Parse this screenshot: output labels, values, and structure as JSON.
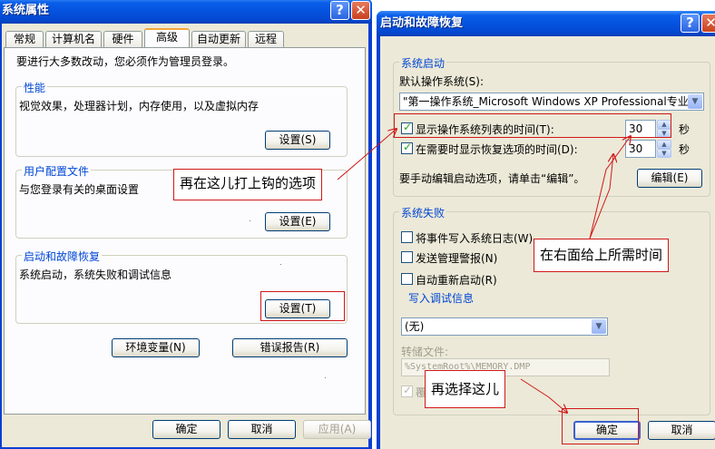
{
  "sys_props": {
    "title": "系统属性",
    "help": "?",
    "close": "✕",
    "tabs": [
      "常规",
      "计算机名",
      "硬件",
      "高级",
      "自动更新",
      "远程"
    ],
    "notice": "要进行大多数改动，您必须作为管理员登录。",
    "performance": {
      "title": "性能",
      "desc": "视觉效果，处理器计划，内存使用，以及虚拟内存",
      "button": "设置(S)"
    },
    "user_profiles": {
      "title": "用户配置文件",
      "desc": "与您登录有关的桌面设置",
      "button": "设置(E)"
    },
    "startup_recovery": {
      "title": "启动和故障恢复",
      "desc": "系统启动，系统失败和调试信息",
      "button": "设置(T)"
    },
    "env_vars": "环境变量(N)",
    "error_report": "错误报告(R)",
    "ok": "确定",
    "cancel": "取消",
    "apply": "应用(A)"
  },
  "startup_dialog": {
    "title": "启动和故障恢复",
    "help": "?",
    "close": "✕",
    "system_startup": {
      "title": "系统启动",
      "default_os_label": "默认操作系统(S):",
      "default_os_value": "\"第一操作系统_Microsoft Windows XP Professional专业",
      "show_list_label": "显示操作系统列表的时间(T):",
      "show_list_value": "30",
      "show_recovery_label": "在需要时显示恢复选项的时间(D):",
      "show_recovery_value": "30",
      "seconds": "秒",
      "edit_hint": "要手动编辑启动选项，请单击“编辑”。",
      "edit_button": "编辑(E)"
    },
    "system_failure": {
      "title": "系统失败",
      "write_event": "将事件写入系统日志(W)",
      "send_alert": "发送管理警报(N)",
      "auto_restart": "自动重新启动(R)",
      "debug_title": "写入调试信息",
      "debug_value": "(无)",
      "dump_file_label": "转储文件:",
      "dump_file_value": "%SystemRoot%\\MEMORY.DMP",
      "overwrite_partial": "覆"
    },
    "ok": "确定",
    "cancel": "取消"
  },
  "annotations": {
    "check_here": "再在这儿打上钩的选项",
    "set_time": "在右面给上所需时间",
    "select_here": "再选择这儿"
  },
  "colors": {
    "annotation": "#d01818",
    "group_title": "#0046d5",
    "title_bar": "#0553e0"
  }
}
